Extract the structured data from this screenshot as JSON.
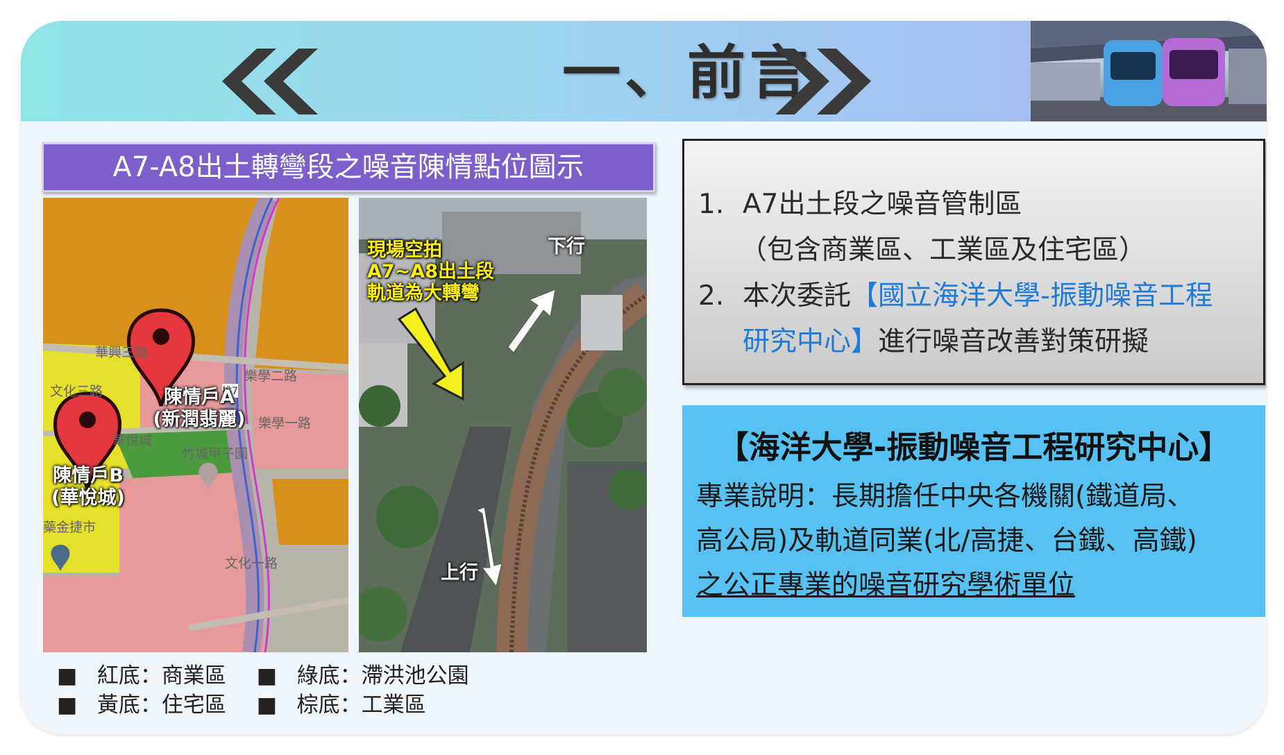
{
  "header": {
    "title": "一、前言"
  },
  "left_panel": {
    "caption": "A7-A8出土轉彎段之噪音陳情點位圖示",
    "map": {
      "pin_a_label_line1": "陳情戶A",
      "pin_a_label_line2": "(新潤翡麗)",
      "pin_b_label_line1": "陳情戶B",
      "pin_b_label_line2": "(華悅城)",
      "street_labels": [
        "華興三路",
        "文化三路",
        "樂學二路",
        "竹城甲子園",
        "樂學一路",
        "文化一路",
        "華悅城",
        "桃7"
      ],
      "metro_label": "藥金捷市"
    },
    "aerial": {
      "caption_line1": "現場空拍",
      "caption_line2": "A7~A8出土段",
      "caption_line3": "軌道為大轉彎",
      "down_label": "下行",
      "up_label": "上行"
    },
    "legend": [
      {
        "bullet": "■",
        "text": "紅底：商業區"
      },
      {
        "bullet": "■",
        "text": "綠底：滯洪池公園"
      },
      {
        "bullet": "■",
        "text": "黃底：住宅區"
      },
      {
        "bullet": "■",
        "text": "棕底：工業區"
      }
    ]
  },
  "right_top": {
    "item1_num": "1.",
    "item1_text": "A7出土段之噪音管制區",
    "item1_sub": "（包含商業區、工業區及住宅區）",
    "item2_num": "2.",
    "item2_prefix": "本次委託",
    "item2_highlight_line1": "【國立海洋大學-振動噪音工程",
    "item2_highlight_line2": "研究中心】",
    "item2_suffix": "進行噪音改善對策研擬"
  },
  "right_bottom": {
    "title": "【海洋大學-振動噪音工程研究中心】",
    "line1": "專業說明：長期擔任中央各機關(鐵道局、",
    "line2": "高公局)及軌道同業(北/高捷、台鐵、高鐵)",
    "line3": "之公正專業的噪音研究學術單位"
  },
  "colors": {
    "caption_bg": "#7d5fc9",
    "highlight": "#1f7bd6",
    "info_bg": "#57c2f2",
    "commercial": "#e89a9a",
    "residential": "#e6e02a",
    "park": "#4b9a3c",
    "industrial": "#d8901c"
  }
}
